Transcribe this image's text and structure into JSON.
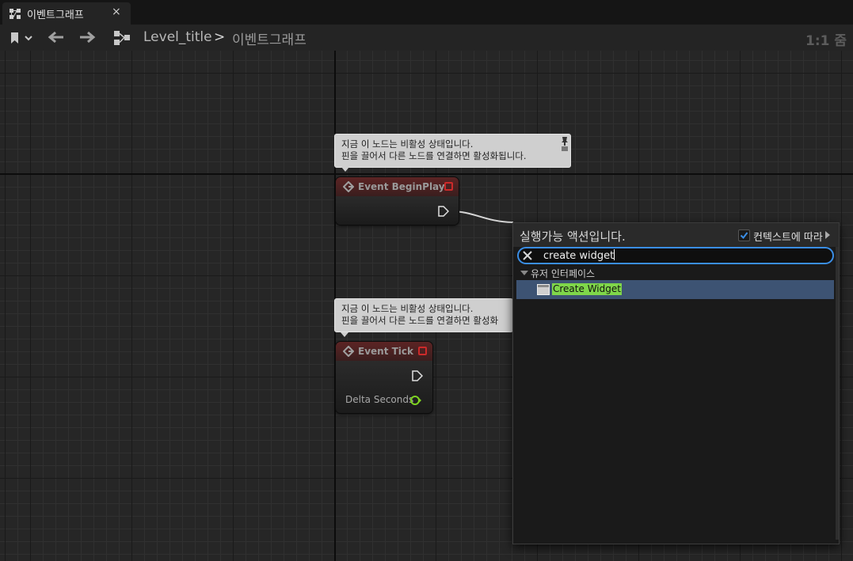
{
  "tab": {
    "label": "이벤트그래프",
    "close": "×"
  },
  "breadcrumb": {
    "level": "Level_title",
    "separator": ">",
    "graph": "이벤트그래프",
    "zoom": "1:1 줌"
  },
  "nodes": {
    "begin_play": {
      "comment_line1": "지금 이 노드는 비활성 상태입니다.",
      "comment_line2": "핀을 끌어서 다른 노드를 연결하면 활성화됩니다.",
      "title": "Event BeginPlay"
    },
    "tick": {
      "comment_line1": "지금 이 노드는 비활성 상태입니다.",
      "comment_line2": "핀을 끌어서 다른 노드를 연결하면 활성화",
      "title": "Event Tick",
      "pin_label": "Delta Seconds"
    }
  },
  "action_menu": {
    "title": "실행가능 액션입니다.",
    "context_label": "컨텍스트에 따라",
    "context_checked": true,
    "search_value": "create widget",
    "category": "유저 인터페이스",
    "items": [
      {
        "label": "Create Widget"
      }
    ]
  },
  "colors": {
    "accent": "#3a8ee6",
    "selection": "#3d5373",
    "highlight": "#7fd64a",
    "event_header": "#5c2424"
  }
}
